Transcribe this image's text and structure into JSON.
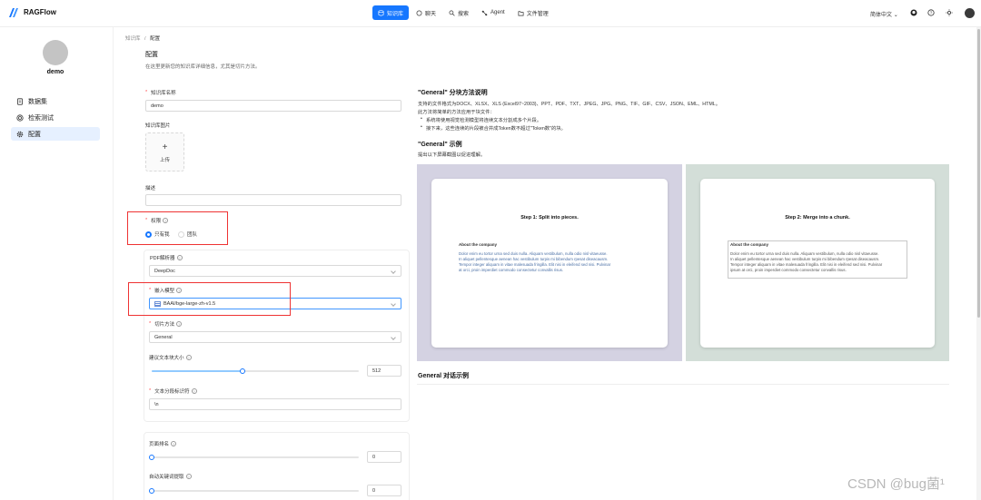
{
  "app": {
    "brand": "RAGFlow"
  },
  "nav": [
    {
      "label": "知识库",
      "icon": "database-icon",
      "active": true
    },
    {
      "label": "聊天",
      "icon": "chat-icon",
      "active": false
    },
    {
      "label": "搜索",
      "icon": "search-icon",
      "active": false
    },
    {
      "label": "Agent",
      "icon": "agent-icon",
      "active": false
    },
    {
      "label": "文件管理",
      "icon": "folder-icon",
      "active": false
    }
  ],
  "header": {
    "language": "简体中文"
  },
  "sidebar": {
    "user_name": "demo",
    "items": [
      {
        "label": "数据集",
        "icon": "file-icon",
        "active": false
      },
      {
        "label": "检索测试",
        "icon": "target-icon",
        "active": false
      },
      {
        "label": "配置",
        "icon": "settings-icon",
        "active": true
      }
    ]
  },
  "breadcrumb": {
    "parent": "知识库",
    "separator": "/",
    "current": "配置"
  },
  "page": {
    "title": "配置",
    "description": "在这里更新您的知识库详细信息，尤其是切片方法。"
  },
  "form": {
    "kb_name": {
      "label": "知识库名称",
      "value": "demo"
    },
    "kb_image": {
      "label": "知识库图片",
      "upload_plus": "+",
      "upload_label": "上传"
    },
    "description": {
      "label": "描述",
      "value": ""
    },
    "permission": {
      "label": "权限",
      "options": [
        "只有我",
        "团队"
      ],
      "selected": "只有我"
    },
    "pdf_parser": {
      "label": "PDF解析器",
      "value": "DeepDoc"
    },
    "embedding_model": {
      "label": "嵌入模型",
      "value": "BAAI/bge-large-zh-v1.5"
    },
    "chunk_method": {
      "label": "切片方法",
      "value": "General"
    },
    "chunk_token_num": {
      "label": "建议文本块大小",
      "value": "512",
      "level": 0.44
    },
    "delimiter": {
      "label": "文本分段标识符",
      "value": "\\n"
    },
    "page_rank": {
      "label": "页面排名",
      "value": "0",
      "level": 0
    },
    "auto_keywords": {
      "label": "自动关键词提取",
      "value": "0",
      "level": 0
    }
  },
  "help_mark": "?",
  "info": {
    "title": "\"General\" 分块方法说明",
    "formats": "支持的文件格式为DOCX、XLSX、XLS (Excel97~2003)、PPT、PDF、TXT、JPEG、JPG、PNG、TIF、GIF、CSV、JSON、EML、HTML。",
    "intro": "此方法将简单的方法应用于块文件：",
    "bullets": [
      "系统将使用视觉检测模型将连续文本分割成多个片段。",
      "接下来，这些连续的片段被合并成Token数不超过\"Token数\"的块。"
    ],
    "example_title": "\"General\" 示例",
    "example_desc": "提出以下屏幕截图以促进理解。",
    "step1": "Step 1: Split into pieces.",
    "step2": "Step 2: Merge into a chunk.",
    "lorem_heading": "About the company",
    "lorem_lines": [
      "Dolor enim eu tortor urna sed duis nulla. Aliquam vestibulum, nulla odio nisl vitaeusse.",
      "In aliquet pellentesque aenean hac vestibulum turpis mi bibendum rpesat diseacausm.",
      "Tempor integer aliquam in vitae malesuada fringilla. Elit nisi in eleifend sed nisi. Pulvinar",
      "at orci, proin imperdiet commodo consectetur convallis risus."
    ],
    "merged_lines": [
      "Dolor enim eu tortor urna sed duis nulla. Aliquam vestibulum, nulla odio nisl vitaeusse.",
      "In aliquet pellentesque aenean hac vestibulum turpis mi bibendum rpesat diseacausm.",
      "Tempor integer aliquam in vitae malesuada fringilla. Elit nisi in eleifend sed nisi. Pulvinar",
      "ipsum at orci, proin imperdiet commodo consectetur convallis risus."
    ],
    "dialog_title": "General 对话示例"
  },
  "watermark": "CSDN @bug菌¹",
  "colors": {
    "accent": "#1677ff",
    "highlight": "#e33333",
    "demo_left_bg": "#d4d2e2",
    "demo_right_bg": "#d3ded8"
  }
}
